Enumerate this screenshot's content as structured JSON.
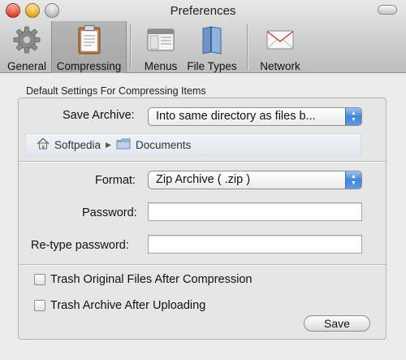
{
  "window": {
    "title": "Preferences"
  },
  "toolbar": {
    "items": [
      {
        "label": "General",
        "icon": "gear-icon",
        "selected": false
      },
      {
        "label": "Compressing",
        "icon": "clipboard-icon",
        "selected": true
      },
      {
        "label": "Menus",
        "icon": "menu-window-icon",
        "selected": false
      },
      {
        "label": "File Types",
        "icon": "file-types-book-icon",
        "selected": false
      },
      {
        "label": "Network",
        "icon": "envelope-icon",
        "selected": false
      }
    ]
  },
  "compressing": {
    "section_caption": "Default Settings For Compressing Items",
    "save_archive": {
      "label": "Save Archive:",
      "value": "Into same directory as files b..."
    },
    "path": {
      "segments": [
        "Softpedia",
        "Documents"
      ]
    },
    "format": {
      "label": "Format:",
      "value": "Zip Archive ( .zip )"
    },
    "password": {
      "label": "Password:",
      "value": ""
    },
    "retype_password": {
      "label": "Re-type password:",
      "value": ""
    },
    "options": [
      {
        "label": "Trash Original Files After Compression",
        "checked": false
      },
      {
        "label": "Trash Archive After Uploading",
        "checked": false
      }
    ],
    "save_button": "Save"
  },
  "colors": {
    "accent_blue": "#3f86dc",
    "toolbar_selected": "#aaaaaa",
    "window_bg": "#ececec"
  }
}
